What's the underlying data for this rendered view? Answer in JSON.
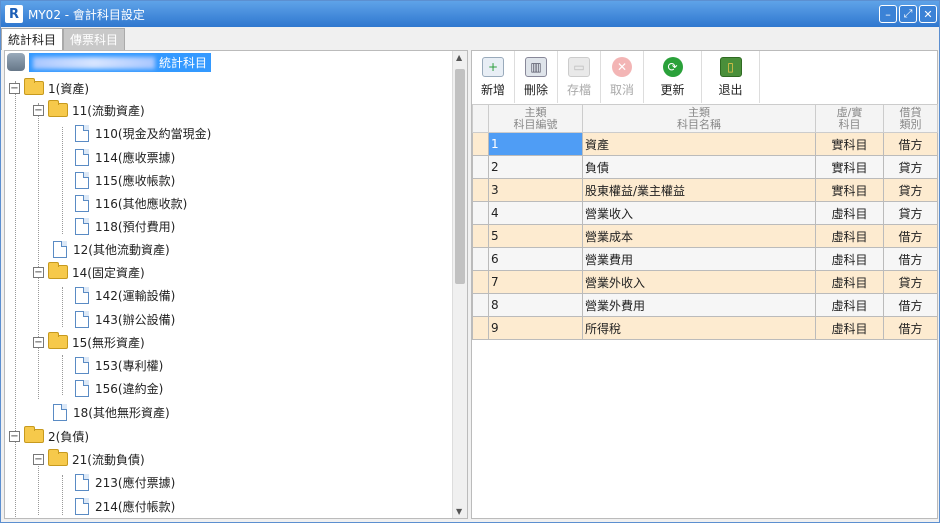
{
  "window": {
    "title": "MY02 - 會計科目設定",
    "logo": "R",
    "min": "–",
    "max": "⤢",
    "close": "✕"
  },
  "tabs": [
    {
      "label": "統計科目"
    },
    {
      "label": "傳票科目"
    }
  ],
  "tree": {
    "root_label": "統計科目",
    "nodes": [
      {
        "label": "1(資產)"
      },
      {
        "label": "11(流動資產)"
      },
      {
        "label": "110(現金及約當現金)"
      },
      {
        "label": "114(應收票據)"
      },
      {
        "label": "115(應收帳款)"
      },
      {
        "label": "116(其他應收款)"
      },
      {
        "label": "118(預付費用)"
      },
      {
        "label": "12(其他流動資產)"
      },
      {
        "label": "14(固定資產)"
      },
      {
        "label": "142(運輸設備)"
      },
      {
        "label": "143(辦公設備)"
      },
      {
        "label": "15(無形資產)"
      },
      {
        "label": "153(專利權)"
      },
      {
        "label": "156(違約金)"
      },
      {
        "label": "18(其他無形資產)"
      },
      {
        "label": "2(負債)"
      },
      {
        "label": "21(流動負債)"
      },
      {
        "label": "213(應付票據)"
      },
      {
        "label": "214(應付帳款)"
      }
    ]
  },
  "toolbar": {
    "add": "新增",
    "delete": "刪除",
    "save": "存檔",
    "cancel": "取消",
    "refresh": "更新",
    "exit": "退出"
  },
  "grid": {
    "headers": {
      "code_top": "主類",
      "code_bottom": "科目編號",
      "name_top": "主類",
      "name_bottom": "科目名稱",
      "type_top": "虛/實",
      "type_bottom": "科目",
      "dc_top": "借貸",
      "dc_bottom": "類別"
    },
    "rows": [
      {
        "code": "1",
        "name": "資產",
        "type": "實科目",
        "dc": "借方"
      },
      {
        "code": "2",
        "name": "負債",
        "type": "實科目",
        "dc": "貸方"
      },
      {
        "code": "3",
        "name": "股東權益/業主權益",
        "type": "實科目",
        "dc": "貸方"
      },
      {
        "code": "4",
        "name": "營業收入",
        "type": "虛科目",
        "dc": "貸方"
      },
      {
        "code": "5",
        "name": "營業成本",
        "type": "虛科目",
        "dc": "借方"
      },
      {
        "code": "6",
        "name": "營業費用",
        "type": "虛科目",
        "dc": "借方"
      },
      {
        "code": "7",
        "name": "營業外收入",
        "type": "虛科目",
        "dc": "貸方"
      },
      {
        "code": "8",
        "name": "營業外費用",
        "type": "虛科目",
        "dc": "借方"
      },
      {
        "code": "9",
        "name": "所得稅",
        "type": "虛科目",
        "dc": "借方"
      }
    ]
  }
}
